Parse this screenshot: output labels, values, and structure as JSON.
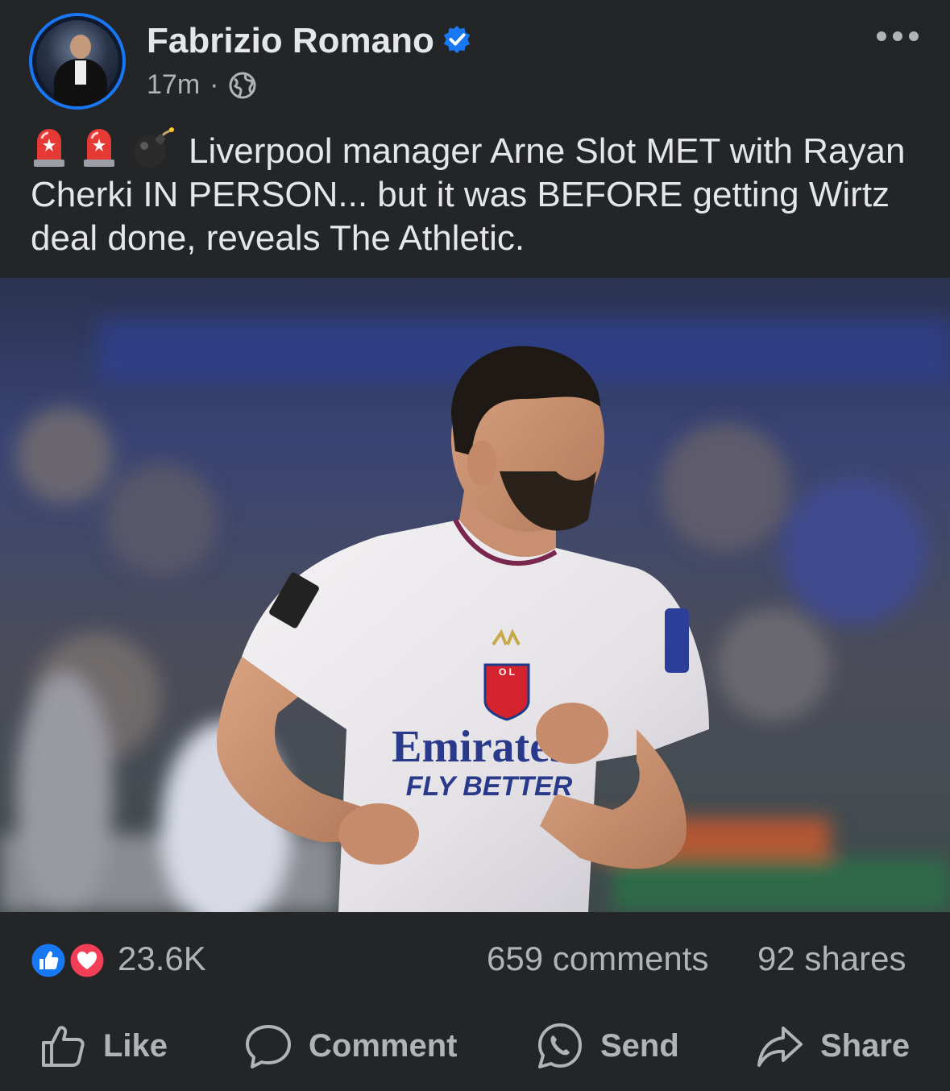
{
  "post": {
    "author": "Fabrizio Romano",
    "time": "17m",
    "separator": "·",
    "text": "Liverpool manager Arne Slot MET with Rayan Cherki IN PERSON... but it was BEFORE getting Wirtz deal done, reveals The Athletic.",
    "photo": {
      "sponsor_main": "Emirates",
      "sponsor_sub": "FLY BETTER",
      "crest": "O L"
    }
  },
  "stats": {
    "reactions": "23.6K",
    "comments": "659 comments",
    "shares": "92 shares"
  },
  "actions": {
    "like": "Like",
    "comment": "Comment",
    "send": "Send",
    "share": "Share"
  },
  "colors": {
    "background": "#242526",
    "accent": "#1877f2",
    "text": "#e4e6eb",
    "muted": "#b0b3b8",
    "love": "#f33e58"
  },
  "icons": [
    "verified-badge-icon",
    "globe-icon",
    "more-options-icon",
    "police-light-icon",
    "bomb-icon",
    "like-reaction-icon",
    "love-reaction-icon",
    "thumbs-up-icon",
    "comment-bubble-icon",
    "whatsapp-icon",
    "share-arrow-icon"
  ]
}
